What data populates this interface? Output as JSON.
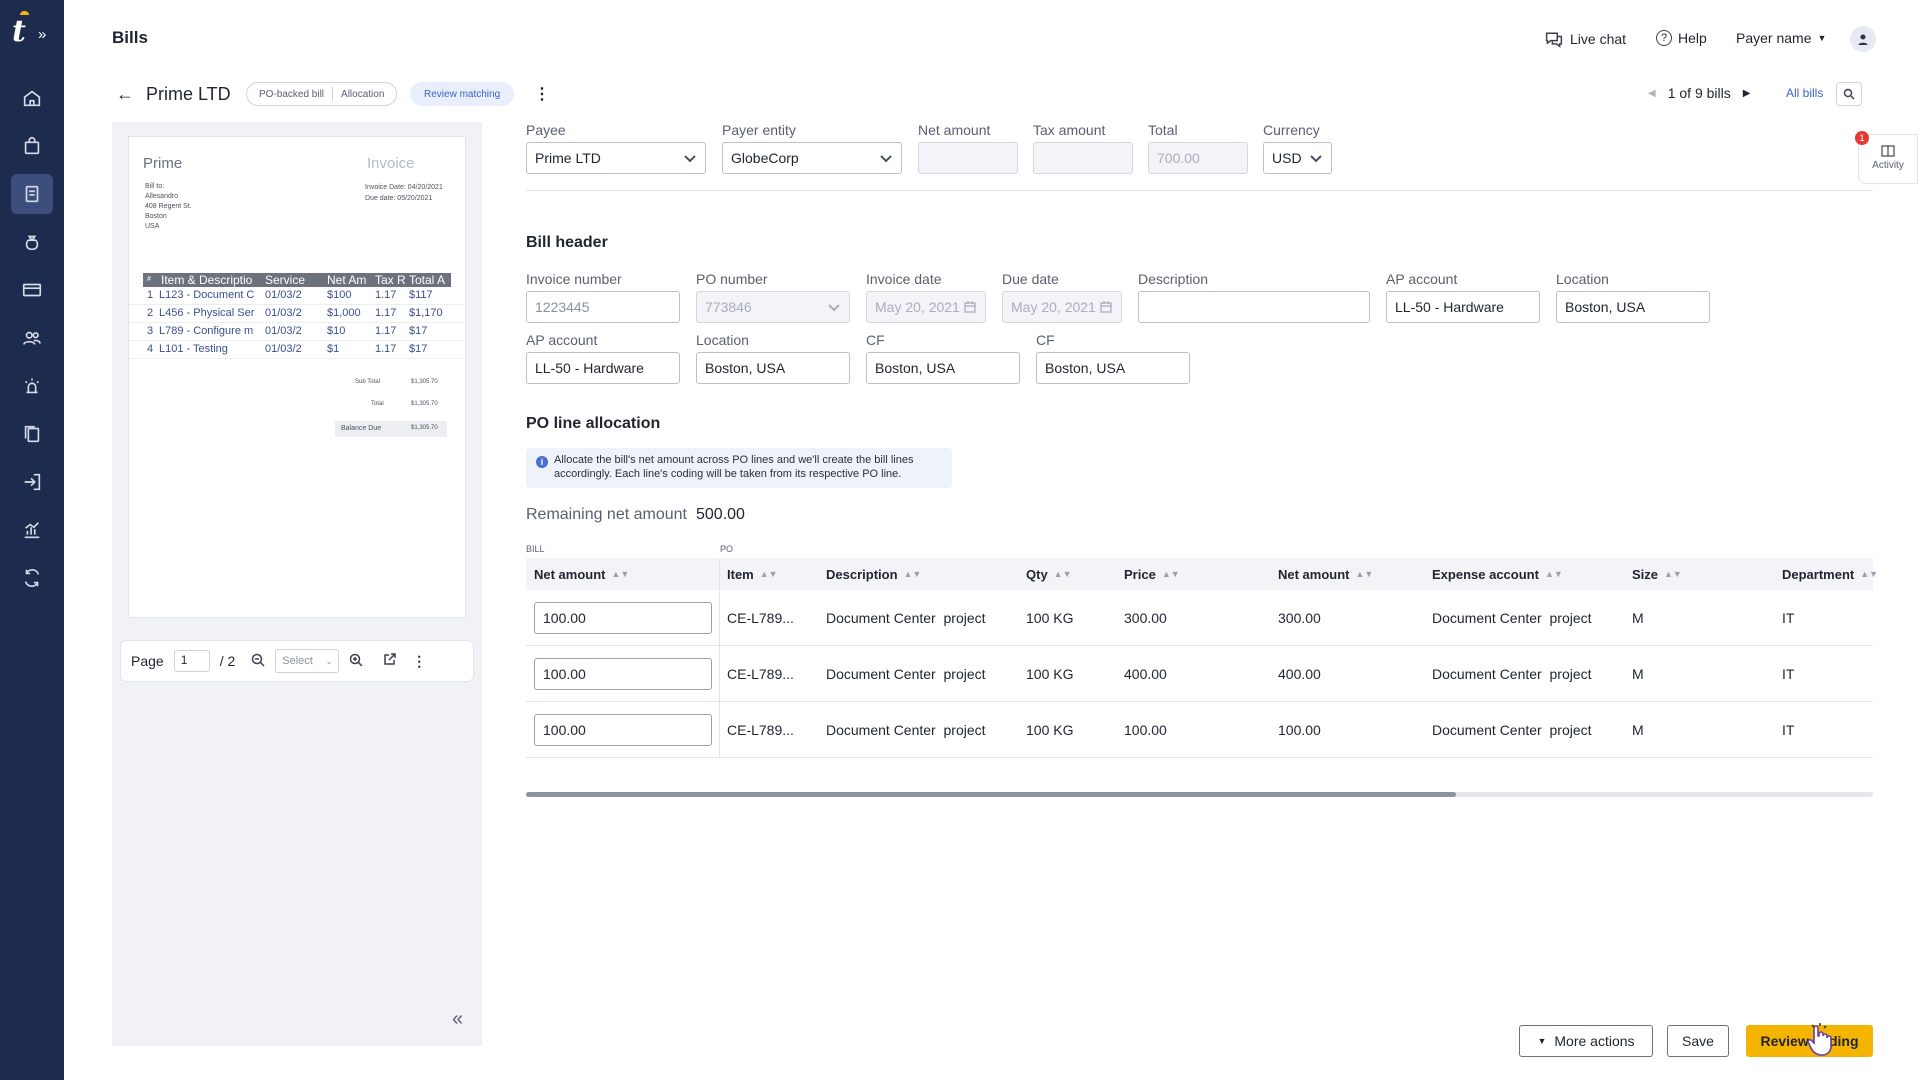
{
  "app": {
    "section_title": "Bills",
    "live_chat": "Live chat",
    "help": "Help",
    "payer": "Payer name"
  },
  "bill": {
    "title": "Prime LTD",
    "tags": [
      "PO-backed bill",
      "Allocation"
    ],
    "review_tag": "Review matching",
    "pager_text": "1 of 9 bills",
    "all_bills": "All bills",
    "activity": "Activity",
    "activity_count": "1"
  },
  "top_fields": {
    "payee": {
      "label": "Payee",
      "value": "Prime LTD"
    },
    "payer_entity": {
      "label": "Payer entity",
      "value": "GlobeCorp"
    },
    "net_amount": {
      "label": "Net amount",
      "value": ""
    },
    "tax_amount": {
      "label": "Tax amount",
      "value": ""
    },
    "total": {
      "label": "Total",
      "value": "700.00"
    },
    "currency": {
      "label": "Currency",
      "value": "USD"
    }
  },
  "bill_header": {
    "title": "Bill header",
    "invoice_number": {
      "label": "Invoice number",
      "value": "1223445"
    },
    "po_number": {
      "label": "PO number",
      "value": "773846"
    },
    "invoice_date": {
      "label": "Invoice date",
      "value": "May 20, 2021"
    },
    "due_date": {
      "label": "Due date",
      "value": "May 20, 2021"
    },
    "description": {
      "label": "Description",
      "value": ""
    },
    "ap_account_1": {
      "label": "AP account",
      "value": "LL-50 - Hardware"
    },
    "location_1": {
      "label": "Location",
      "value": "Boston, USA"
    },
    "ap_account_2": {
      "label": "AP account",
      "value": "LL-50 - Hardware"
    },
    "location_2": {
      "label": "Location",
      "value": "Boston, USA"
    },
    "cf_1": {
      "label": "CF",
      "value": "Boston, USA"
    },
    "cf_2": {
      "label": "CF",
      "value": "Boston, USA"
    }
  },
  "po_allocation": {
    "title": "PO line allocation",
    "info": "Allocate the bill's net amount across PO lines and we'll create the bill lines accordingly. Each line's coding will be taken from its respective PO line.",
    "remaining_label": "Remaining net amount",
    "remaining_value": "500.00",
    "group_bill": "BILL",
    "group_po": "PO",
    "columns": [
      "Net amount",
      "Item",
      "Description",
      "Qty",
      "Price",
      "Net amount",
      "Expense account",
      "Size",
      "Department"
    ],
    "rows": [
      {
        "bill_net": "100.00",
        "item": "CE-L789...",
        "description": "Document Center  project",
        "qty": "100 KG",
        "price": "300.00",
        "net": "300.00",
        "expense": "Document Center  project",
        "size": "M",
        "dept": "IT"
      },
      {
        "bill_net": "100.00",
        "item": "CE-L789...",
        "description": "Document Center  project",
        "qty": "100 KG",
        "price": "400.00",
        "net": "400.00",
        "expense": "Document Center  project",
        "size": "M",
        "dept": "IT"
      },
      {
        "bill_net": "100.00",
        "item": "CE-L789...",
        "description": "Document Center  project",
        "qty": "100 KG",
        "price": "100.00",
        "net": "100.00",
        "expense": "Document Center  project",
        "size": "M",
        "dept": "IT"
      }
    ]
  },
  "preview": {
    "company": "Prime",
    "doc_type": "Invoice",
    "bill_to": [
      "Bill to:",
      "Allesandro",
      "408 Regent St.",
      "Boston",
      "USA"
    ],
    "dates": [
      "Invoice Date: 04/20/2021",
      "Due date: 05/20/2021"
    ],
    "columns": [
      "#",
      "Item & Descriptio",
      "Service",
      "Net Am",
      "Tax R",
      "Total A"
    ],
    "lines": [
      {
        "n": "1",
        "item": "L123 - Document C",
        "date": "01/03/2",
        "net": "$100",
        "tax": "1.17",
        "total": "$117"
      },
      {
        "n": "2",
        "item": "L456 - Physical Ser",
        "date": "01/03/2",
        "net": "$1,000",
        "tax": "1.17",
        "total": "$1,170"
      },
      {
        "n": "3",
        "item": "L789 - Configure m",
        "date": "01/03/2",
        "net": "$10",
        "tax": "1.17",
        "total": "$17"
      },
      {
        "n": "4",
        "item": "L101 - Testing",
        "date": "01/03/2",
        "net": "$1",
        "tax": "1.17",
        "total": "$17"
      }
    ],
    "subtotal_label": "Sub Total",
    "subtotal": "$1,305.70",
    "total_label": "Total",
    "total": "$1,305.70",
    "balance_label": "Balance Due",
    "balance": "$1,305.70",
    "page_label": "Page",
    "page_value": "1",
    "page_total": "/ 2",
    "zoom_select": "Select"
  },
  "footer": {
    "more_actions": "More actions",
    "save": "Save",
    "review_coding": "Review coding"
  },
  "colors": {
    "sidebar": "#1d2b4f",
    "accent": "#f5b400",
    "link": "#3d63c9"
  }
}
